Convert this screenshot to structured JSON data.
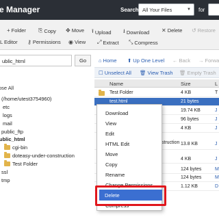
{
  "header": {
    "title": "e Manager",
    "search_label": "Search",
    "search_scope": "All Your Files",
    "for_label": "for"
  },
  "toolbar": {
    "row1": [
      {
        "icon": "plus-icon",
        "glyph": "+",
        "label": "Folder"
      },
      {
        "icon": "copy-icon",
        "glyph": "⎘",
        "label": "Copy"
      },
      {
        "icon": "move-icon",
        "glyph": "✥",
        "label": "Move"
      },
      {
        "icon": "upload-icon",
        "glyph": "⭱",
        "label": "Upload"
      },
      {
        "icon": "download-icon",
        "glyph": "⭳",
        "label": "Download"
      },
      {
        "icon": "delete-x-icon",
        "glyph": "✕",
        "label": "Delete"
      },
      {
        "icon": "restore-icon",
        "glyph": "↺",
        "label": "Restore"
      }
    ],
    "row2": [
      {
        "icon": "edit-icon",
        "glyph": "",
        "label": "L Editor"
      },
      {
        "icon": "key-icon",
        "glyph": "⚷",
        "label": "Permissions"
      },
      {
        "icon": "eye-icon",
        "glyph": "◉",
        "label": "View"
      },
      {
        "icon": "extract-icon",
        "glyph": "⤢",
        "label": "Extract"
      },
      {
        "icon": "compress-icon",
        "glyph": "⤡",
        "label": "Compress"
      }
    ]
  },
  "sidebar": {
    "path_value": "ublic_html",
    "go_label": "Go",
    "collapse_all": "ose All",
    "tree": [
      {
        "label": "(/home/utest3754960)",
        "bold": false,
        "folder": false
      },
      {
        "label": "etc",
        "bold": false,
        "folder": false
      },
      {
        "label": "logs",
        "bold": false,
        "folder": false
      },
      {
        "label": "mail",
        "bold": false,
        "folder": false
      },
      {
        "label": "public_ftp",
        "bold": false,
        "folder": false
      },
      {
        "label": "ublic_html",
        "bold": true,
        "folder": false
      },
      {
        "label": "cgi-bin",
        "bold": false,
        "folder": true
      },
      {
        "label": "doteasy-under-construction",
        "bold": false,
        "folder": true
      },
      {
        "label": "Test Folder",
        "bold": false,
        "folder": true
      },
      {
        "label": "ssl",
        "bold": false,
        "folder": false
      },
      {
        "label": "tmp",
        "bold": false,
        "folder": false
      }
    ]
  },
  "nav": {
    "home": "Home",
    "up_one_level": "Up One Level",
    "back": "Back",
    "forward": "Forwa",
    "unselect_all": "Unselect All",
    "view_trash": "View Trash",
    "empty_trash": "Empty Trash"
  },
  "table": {
    "columns": [
      "Name",
      "Size",
      "L"
    ],
    "rows": [
      {
        "name": "Test Folder",
        "size": "4 KB",
        "type": "T",
        "selected": false
      },
      {
        "name": "test.html",
        "size": "21 bytes",
        "type": "",
        "selected": true
      },
      {
        "name": "",
        "size": "19.74 KB",
        "type": "J",
        "selected": false
      },
      {
        "name": "",
        "size": "96 bytes",
        "type": "J",
        "selected": false
      },
      {
        "name": "",
        "size": "4 KB",
        "type": "J",
        "selected": false
      },
      {
        "name": "nstruction",
        "size": "13.8 KB",
        "type": "J",
        "selected": false
      },
      {
        "name": "",
        "size": "4 KB",
        "type": "J",
        "selected": false
      },
      {
        "name": "",
        "size": "124 bytes",
        "type": "M",
        "selected": false
      },
      {
        "name": "",
        "size": "124 bytes",
        "type": "M",
        "selected": false
      },
      {
        "name": "",
        "size": "1.12 KB",
        "type": "D",
        "selected": false
      }
    ]
  },
  "context_menu": {
    "items": [
      "Download",
      "View",
      "Edit",
      "HTML Edit",
      "Move",
      "Copy",
      "Rename",
      "Change Permissions",
      "Delete",
      "Compress"
    ],
    "highlighted": "Delete"
  },
  "colors": {
    "header_bg": "#2b2f36",
    "selection": "#3a6fc0",
    "menu_highlight": "#3b6fd1",
    "annotation_red": "#e0161c",
    "folder": "#e2b44b"
  }
}
